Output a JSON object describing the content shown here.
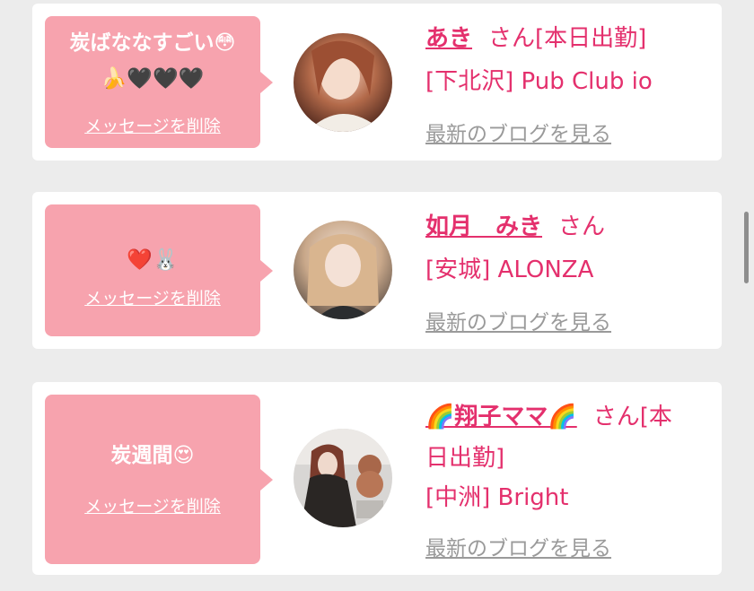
{
  "cards": [
    {
      "message_text": "炭ばななすごい😳",
      "message_emojis": "🍌🖤🖤🖤",
      "delete_label": "メッセージを削除",
      "name": "あき",
      "honorific_line": "さん[本日出勤]",
      "area": "[下北沢] Pub Club io",
      "blog_label": "最新のブログを見る"
    },
    {
      "message_text": "",
      "message_emojis": "❤️🐰",
      "delete_label": "メッセージを削除",
      "name": "如月　みき",
      "honorific_line": "さん",
      "area": "[安城] ALONZA",
      "blog_label": "最新のブログを見る"
    },
    {
      "message_text": "炭週間😍",
      "message_emojis": "",
      "delete_label": "メッセージを削除",
      "name": "🌈翔子ママ🌈",
      "honorific_line": "さん[本",
      "honorific_line2": "日出勤]",
      "area": "[中洲] Bright",
      "blog_label": "最新のブログを見る"
    }
  ],
  "colors": {
    "bubble": "#f7a3ae",
    "accent_text": "#e4306d",
    "link_gray": "#9a9a9a",
    "page_bg": "#ececec"
  }
}
